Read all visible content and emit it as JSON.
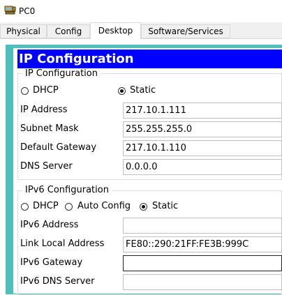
{
  "window": {
    "title": "PC0",
    "icon": "pc-icon"
  },
  "tabs": [
    {
      "label": "Physical"
    },
    {
      "label": "Config"
    },
    {
      "label": "Desktop",
      "active": true
    },
    {
      "label": "Software/Services"
    }
  ],
  "panel": {
    "header": "IP Configuration",
    "accent_color": "#0000ff",
    "border_color": "#4fbfbd"
  },
  "ipv4": {
    "legend": "IP Configuration",
    "mode_options": [
      "DHCP",
      "Static"
    ],
    "selected_mode": "Static",
    "fields": [
      {
        "label": "IP Address",
        "value": "217.10.1.111"
      },
      {
        "label": "Subnet Mask",
        "value": "255.255.255.0"
      },
      {
        "label": "Default Gateway",
        "value": "217.10.1.110"
      },
      {
        "label": "DNS Server",
        "value": "0.0.0.0"
      }
    ]
  },
  "ipv6": {
    "legend": "IPv6 Configuration",
    "mode_options": [
      "DHCP",
      "Auto Config",
      "Static"
    ],
    "selected_mode": "Static",
    "fields": [
      {
        "label": "IPv6 Address",
        "value": ""
      },
      {
        "label": "Link Local Address",
        "value": "FE80::290:21FF:FE3B:999C"
      },
      {
        "label": "IPv6 Gateway",
        "value": ""
      },
      {
        "label": "IPv6 DNS Server",
        "value": ""
      }
    ]
  }
}
